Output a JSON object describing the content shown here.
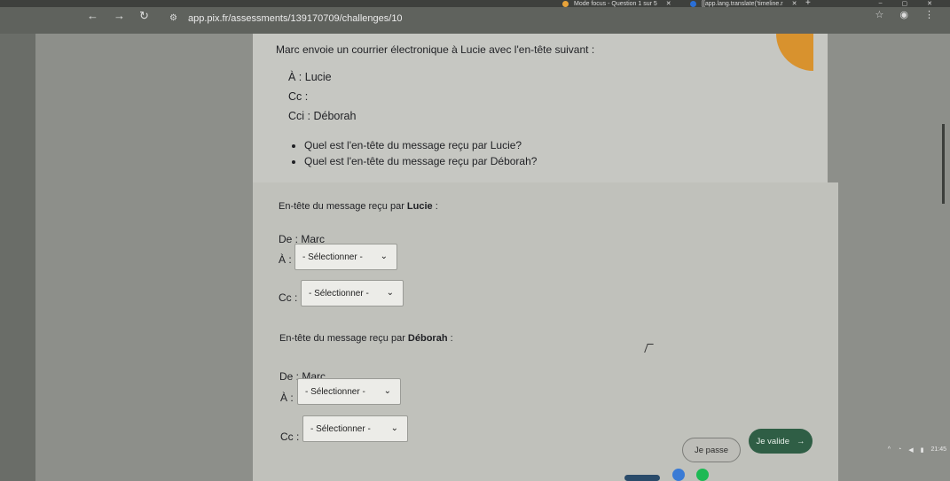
{
  "browser": {
    "tabs": [
      {
        "title": "Mode focus - Question 1 sur 5"
      },
      {
        "title": "[[app.lang.translate('timeline.r"
      }
    ],
    "new_tab": "+",
    "window_controls": [
      "–",
      "▢",
      "✕"
    ],
    "nav_icons": [
      "back-icon",
      "forward-icon",
      "reload-icon"
    ],
    "url": "app.pix.fr/assessments/139170709/challenges/10"
  },
  "question": {
    "intro": "Marc envoie un courrier électronique à Lucie avec l'en-tête suivant :",
    "header_lines": [
      "À : Lucie",
      "Cc :",
      "Cci : Déborah"
    ],
    "bullets": [
      "Quel est l'en-tête du message reçu par Lucie?",
      "Quel est l'en-tête du message reçu par Déborah?"
    ]
  },
  "answers": {
    "lucie": {
      "label_prefix": "En-tête du message reçu par",
      "label_name": "Lucie",
      "label_suffix": ":",
      "de": "De : Marc",
      "a_label": "À :",
      "a_value": "- Sélectionner -",
      "cc_label": "Cc :",
      "cc_value": "- Sélectionner -"
    },
    "deborah": {
      "label_prefix": "En-tête du message reçu par",
      "label_name": "Déborah",
      "label_suffix": ":",
      "de": "De : Marc",
      "a_label": "À :",
      "a_value": "- Sélectionner -",
      "cc_label": "Cc :",
      "cc_value": "- Sélectionner -"
    }
  },
  "actions": {
    "skip": "Je passe",
    "validate": "Je valide",
    "validate_arrow": "→"
  },
  "system": {
    "clock": "21:45"
  },
  "colors": {
    "validate_button": "#2f5e45",
    "ribbon": "#d8922e"
  }
}
